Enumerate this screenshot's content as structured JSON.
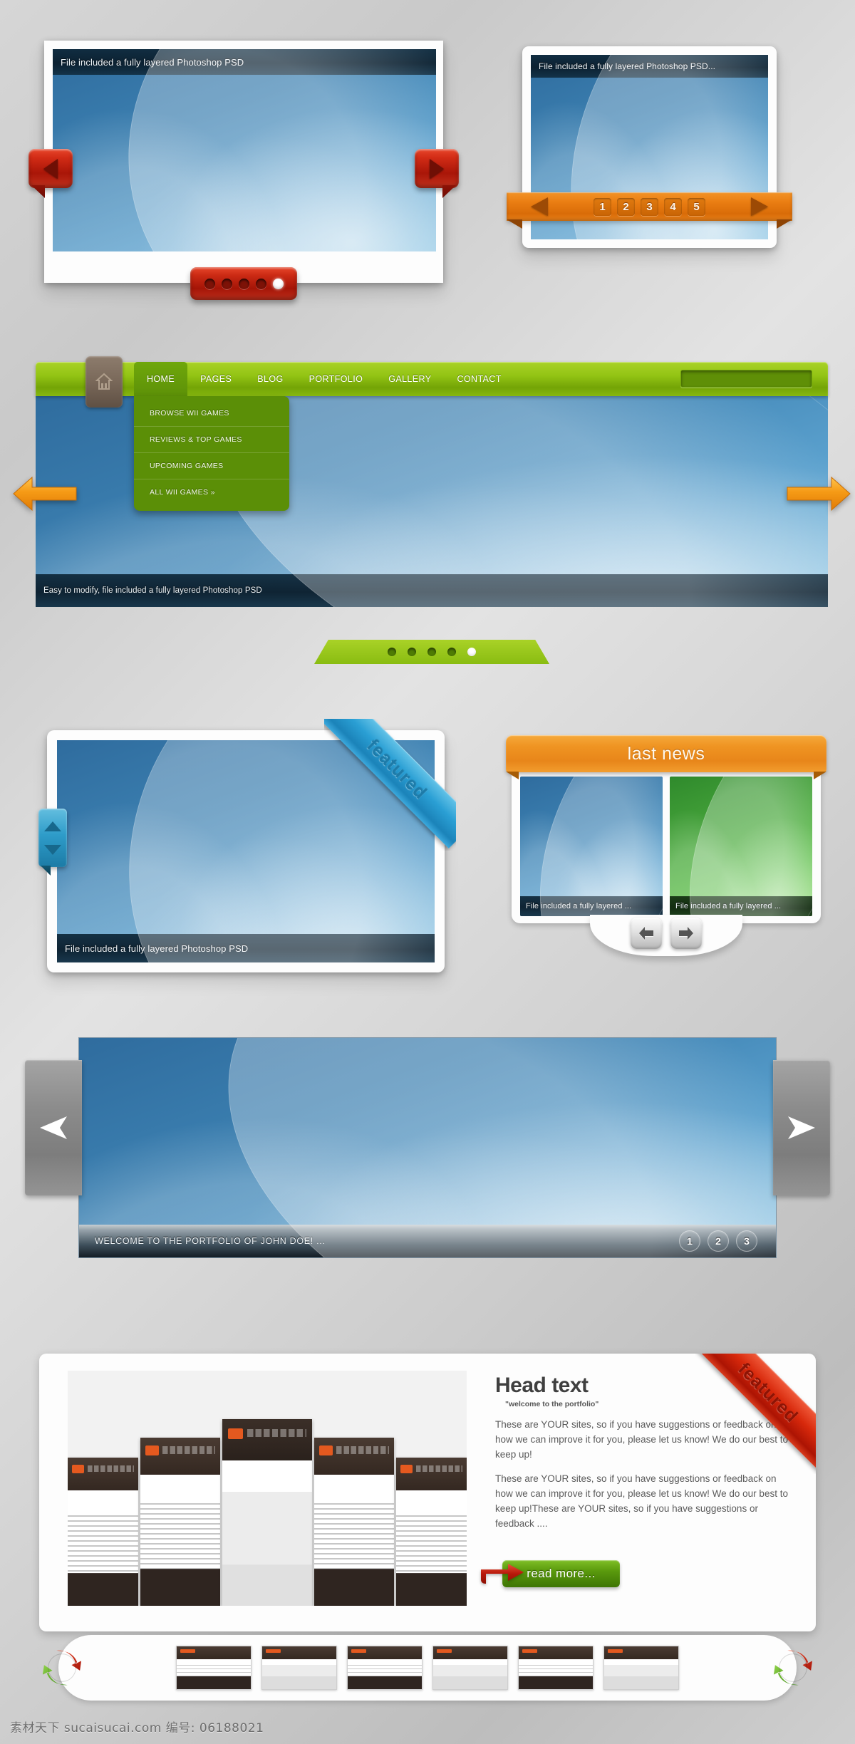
{
  "panel_top_left": {
    "caption": "File included a fully layered Photoshop PSD",
    "prev_icon": "left-arrow-icon",
    "next_icon": "right-arrow-icon",
    "dots": [
      "",
      "",
      "",
      "",
      ""
    ],
    "active_dot_index": 4,
    "accent": "#c12a12"
  },
  "panel_top_right": {
    "caption": "File included a fully layered Photoshop PSD...",
    "prev_icon": "left-arrow-icon",
    "next_icon": "right-arrow-icon",
    "pager": [
      "1",
      "2",
      "3",
      "4",
      "5"
    ],
    "accent": "#e8811a"
  },
  "navigation": {
    "home_icon": "home-icon",
    "items": [
      {
        "label": "HOME",
        "active": true
      },
      {
        "label": "PAGES",
        "active": false
      },
      {
        "label": "BLOG",
        "active": false
      },
      {
        "label": "PORTFOLIO",
        "active": false
      },
      {
        "label": "GALLERY",
        "active": false
      },
      {
        "label": "CONTACT",
        "active": false
      }
    ],
    "dropdown": [
      "BROWSE WII GAMES",
      "REVIEWS & TOP GAMES",
      "UPCOMING GAMES",
      "ALL WII GAMES »"
    ],
    "search": {
      "value": "",
      "placeholder": ""
    },
    "stage_caption": "Easy to modify, file included a fully layered Photoshop PSD",
    "prev_icon": "orange-left-arrow-icon",
    "next_icon": "orange-right-arrow-icon",
    "tab_dots": [
      "",
      "",
      "",
      "",
      ""
    ],
    "active_tab_dot_index": 4,
    "accent": "#93c414"
  },
  "panel_featured": {
    "caption": "File included a fully layered Photoshop PSD",
    "ribbon_label": "featured",
    "scroll_up_icon": "up-arrow-icon",
    "scroll_down_icon": "down-arrow-icon",
    "accent": "#2a9fd4"
  },
  "last_news": {
    "title": "last news",
    "items": [
      {
        "caption": "File included a fully layered ...",
        "color": "blue"
      },
      {
        "caption": "File included a fully layered ...",
        "color": "green"
      }
    ],
    "prev_icon": "left-arrow-icon",
    "next_icon": "right-arrow-icon",
    "accent": "#ef9422"
  },
  "wide_slider": {
    "caption": "WELCOME TO THE PORTFOLIO OF JOHN DOE! ...",
    "prev_icon": "left-arrow-icon",
    "next_icon": "right-arrow-icon",
    "pager": [
      "1",
      "2",
      "3"
    ],
    "active_page": "1"
  },
  "head_card": {
    "heading": "Head text",
    "subheading": "\"welcome to the portfolio\"",
    "paragraph1": "These are YOUR sites, so if you have suggestions or feedback on how we can improve it for you, please let us know! We do our best to keep up!",
    "paragraph2": "These are YOUR sites, so if you have suggestions or feedback on how we can improve it for you, please let us know! We do our best to keep up!These are YOUR sites, so if you have suggestions or feedback ....",
    "read_more_label": "read more...",
    "read_more_icon": "red-arrow-icon",
    "ribbon_label": "featured"
  },
  "carousel": {
    "left_icon": "recycle-icon",
    "right_icon": "recycle-icon",
    "thumb_count": 6
  },
  "footer": {
    "watermark": "素材天下 sucaisucai.com  编号: 06188021"
  }
}
